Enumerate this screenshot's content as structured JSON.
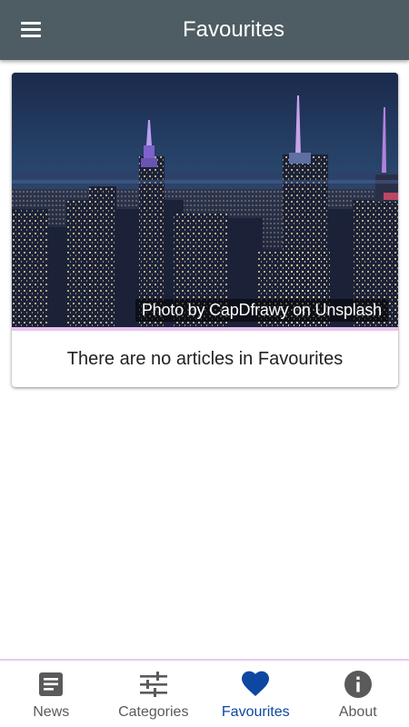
{
  "appbar": {
    "title": "Favourites",
    "menu_icon": "menu-icon",
    "background_color": "#4e5d63"
  },
  "card": {
    "image_description_icon": "city-skyline-photo",
    "photo_credit": "Photo by CapDfrawy on Unsplash",
    "empty_message": "There are no articles in Favourites"
  },
  "bottom_nav": {
    "active_color": "#0d47a1",
    "inactive_color": "#5a5a5a",
    "items": [
      {
        "label": "News",
        "icon": "article-icon",
        "active": false
      },
      {
        "label": "Categories",
        "icon": "sliders-icon",
        "active": false
      },
      {
        "label": "Favourites",
        "icon": "heart-icon",
        "active": true
      },
      {
        "label": "About",
        "icon": "info-icon",
        "active": false
      }
    ]
  }
}
